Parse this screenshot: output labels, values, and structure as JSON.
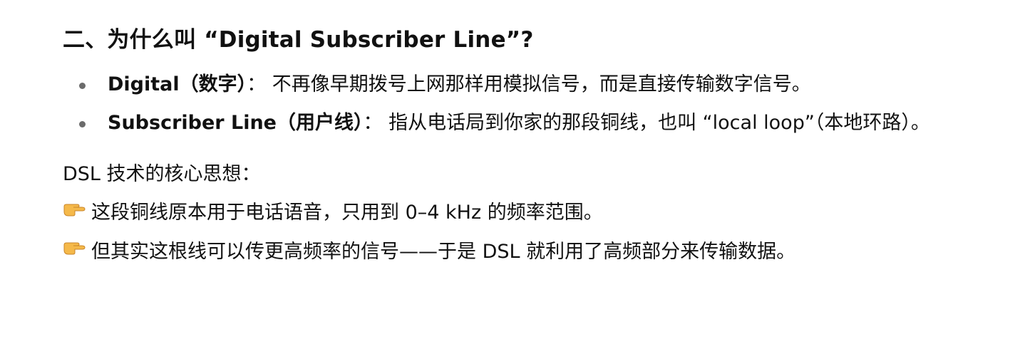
{
  "section": {
    "heading": "二、为什么叫 “Digital Subscriber Line”?"
  },
  "bullets": [
    {
      "term": "Digital（数字）",
      "sep": "：",
      "text": "不再像早期拨号上网那样用模拟信号，而是直接传输数字信号。"
    },
    {
      "term": "Subscriber Line（用户线）",
      "sep": "：",
      "text": "指从电话局到你家的那段铜线，也叫 “local loop”（本地环路）。"
    }
  ],
  "core_idea": {
    "label": "DSL 技术的核心思想：",
    "points": [
      {
        "icon": "pointing-hand-icon",
        "text": "这段铜线原本用于电话语音，只用到 0–4 kHz 的频率范围。"
      },
      {
        "icon": "pointing-hand-icon",
        "text": "但其实这根线可以传更高频率的信号——于是 DSL 就利用了高频部分来传输数据。"
      }
    ]
  },
  "colors": {
    "text": "#111111",
    "bullet_dot": "#6b6b6b",
    "emoji_hand": "#f5b94a"
  }
}
